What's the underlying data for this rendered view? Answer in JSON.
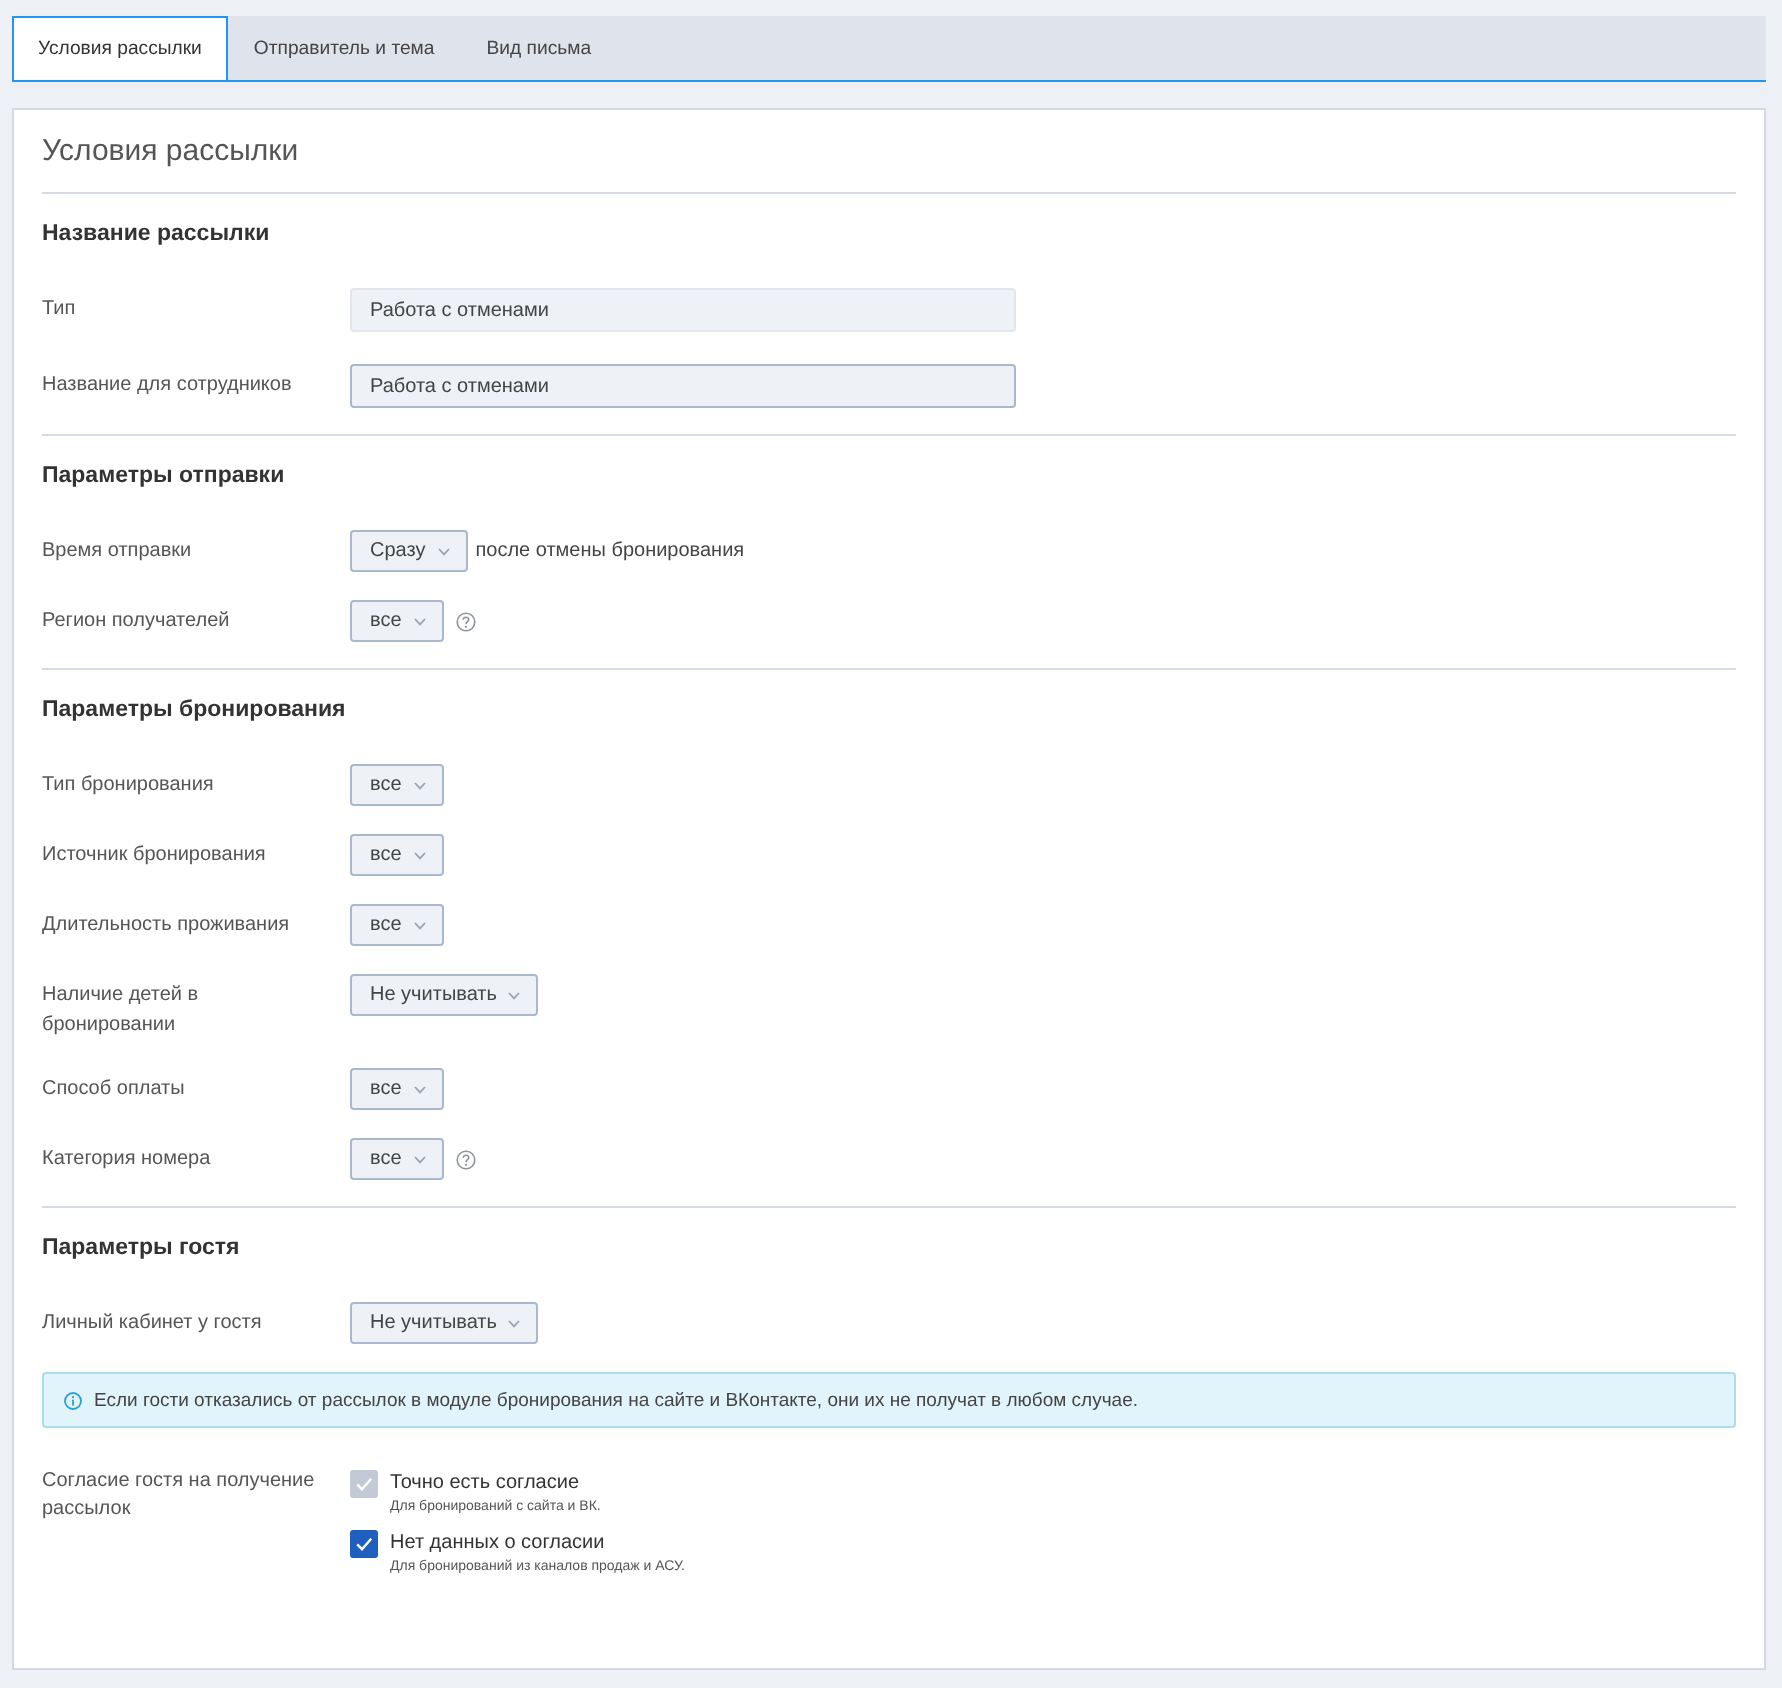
{
  "tabs": [
    {
      "label": "Условия рассылки",
      "selected": true
    },
    {
      "label": "Отправитель и тема",
      "selected": false
    },
    {
      "label": "Вид письма",
      "selected": false
    }
  ],
  "panel": {
    "title": "Условия рассылки",
    "sections": [
      {
        "heading": "Название рассылки",
        "rows": [
          {
            "kind": "input",
            "label": "Тип",
            "value": "Работа с отменами",
            "disabled": true
          },
          {
            "kind": "input",
            "label": "Название для сотрудников",
            "value": "Работа с отменами",
            "disabled": false
          }
        ]
      },
      {
        "heading": "Параметры отправки",
        "rows": [
          {
            "kind": "select",
            "label": "Время отправки",
            "value": "Сразу",
            "suffix": "после отмены бронирования",
            "help": false
          },
          {
            "kind": "select",
            "label": "Регион получателей",
            "value": "все",
            "help": true
          }
        ]
      },
      {
        "heading": "Параметры бронирования",
        "rows": [
          {
            "kind": "select",
            "label": "Тип бронирования",
            "value": "все",
            "help": false
          },
          {
            "kind": "select",
            "label": "Источник бронирования",
            "value": "все",
            "help": false
          },
          {
            "kind": "select",
            "label": "Длительность проживания",
            "value": "все",
            "help": false
          },
          {
            "kind": "select",
            "label": "Наличие детей в бронировании",
            "value": "Не учитывать",
            "help": false
          },
          {
            "kind": "select",
            "label": "Способ оплаты",
            "value": "все",
            "help": false
          },
          {
            "kind": "select",
            "label": "Категория номера",
            "value": "все",
            "help": true
          }
        ]
      },
      {
        "heading": "Параметры гостя",
        "rows": [
          {
            "kind": "select",
            "label": "Личный кабинет у гостя",
            "value": "Не учитывать",
            "help": false
          },
          {
            "kind": "alert",
            "text": "Если гости отказались от рассылок в модуле бронирования на сайте и ВКонтакте, они их не получат в любом случае."
          },
          {
            "kind": "checkboxes",
            "label": "Согласие гостя на получение рассылок",
            "options": [
              {
                "label": "Точно есть согласие",
                "hint": "Для бронирований с сайта и ВК.",
                "checked": true,
                "disabled": true
              },
              {
                "label": "Нет данных о согласии",
                "hint": "Для бронирований из каналов продаж и АСУ.",
                "checked": true,
                "disabled": false
              }
            ]
          }
        ]
      }
    ]
  }
}
